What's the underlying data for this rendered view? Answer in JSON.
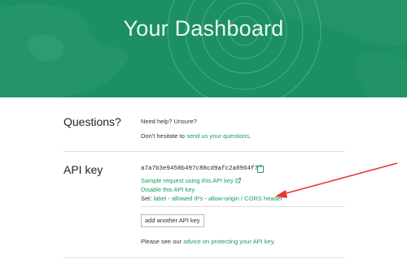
{
  "hero": {
    "title": "Your Dashboard"
  },
  "questions": {
    "label": "Questions?",
    "line1": "Need help? Unsure?",
    "line2_prefix": "Don't hesitate to ",
    "line2_link": "send us your questions",
    "line2_suffix": "."
  },
  "apikey": {
    "label": "API key",
    "key_value": "a7a7b3e9458b497c88cd9afc2a8964f7",
    "copy_icon": "clipboard-icon",
    "sample_link": "Sample request using this API key",
    "disable_link": "Disable this API key",
    "set_prefix": "Set: ",
    "set_links": [
      "label",
      "allowed IPs",
      "allow-origin / CORS header"
    ],
    "set_separator": " - ",
    "add_button": "add another API key",
    "advice_prefix": "Please see our ",
    "advice_link": "advice on protecting your API key",
    "advice_suffix": "."
  },
  "colors": {
    "brand_green": "#1c8f63",
    "link_green": "#1a9a62",
    "arrow_red": "#e53935"
  }
}
